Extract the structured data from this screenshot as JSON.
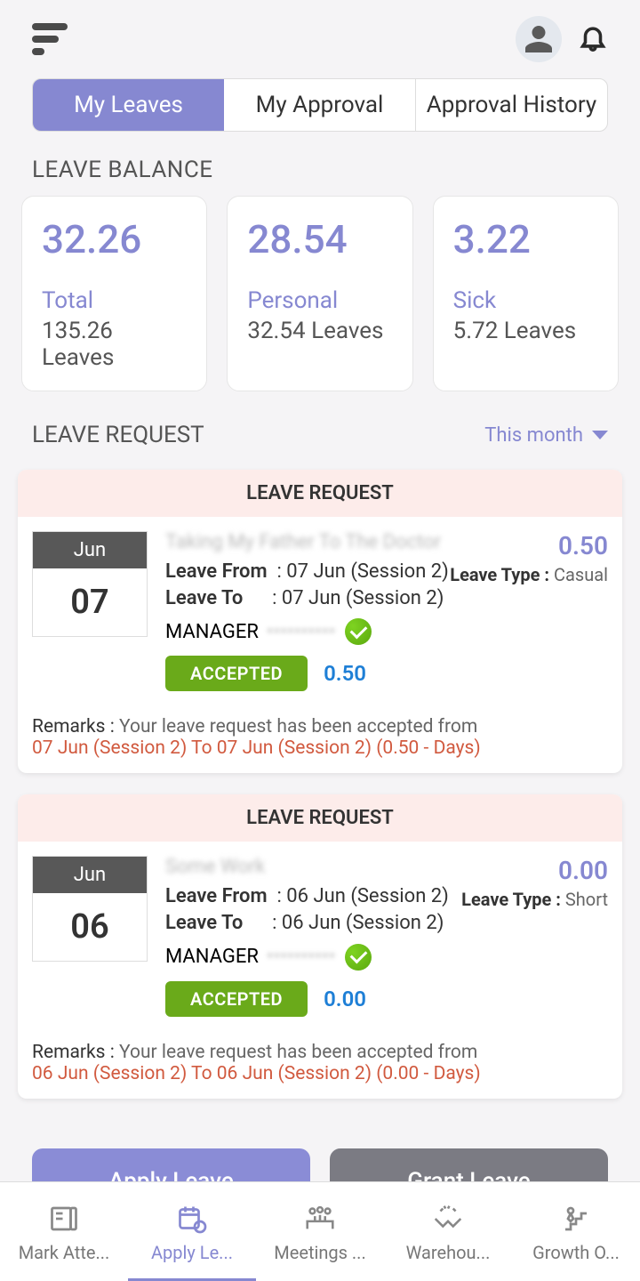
{
  "header": {},
  "tabs": {
    "my_leaves": "My Leaves",
    "my_approval": "My Approval",
    "approval_history": "Approval History"
  },
  "sections": {
    "balance_title": "LEAVE BALANCE",
    "request_title": "LEAVE REQUEST"
  },
  "balance": [
    {
      "value": "32.26",
      "label": "Total",
      "sub": "135.26 Leaves"
    },
    {
      "value": "28.54",
      "label": "Personal",
      "sub": "32.54 Leaves"
    },
    {
      "value": "3.22",
      "label": "Sick",
      "sub": "5.72 Leaves"
    }
  ],
  "filter": {
    "label": "This month"
  },
  "leaves": [
    {
      "header": "LEAVE REQUEST",
      "month": "Jun",
      "day": "07",
      "reason": "Taking My Father To The Doctor",
      "amount": "0.50",
      "from_label": "Leave From",
      "from_value": "07 Jun (Session 2)",
      "to_label": "Leave To",
      "to_value": "07 Jun (Session 2)",
      "leave_type_label": "Leave Type :",
      "leave_type_value": "Casual",
      "manager_label": "MANAGER",
      "manager_name": "··········",
      "status": "ACCEPTED",
      "status_amount": "0.50",
      "remarks_label": "Remarks :",
      "remarks_text": "Your leave request has been accepted from",
      "remarks_highlight": "07 Jun (Session 2) To 07 Jun (Session 2) (0.50 - Days)"
    },
    {
      "header": "LEAVE REQUEST",
      "month": "Jun",
      "day": "06",
      "reason": "Some Work",
      "amount": "0.00",
      "from_label": "Leave From",
      "from_value": "06 Jun (Session 2)",
      "to_label": "Leave To",
      "to_value": "06 Jun (Session 2)",
      "leave_type_label": "Leave Type :",
      "leave_type_value": "Short",
      "manager_label": "MANAGER",
      "manager_name": "··········",
      "status": "ACCEPTED",
      "status_amount": "0.00",
      "remarks_label": "Remarks :",
      "remarks_text": "Your leave request has been accepted from",
      "remarks_highlight": "06 Jun (Session 2) To 06 Jun (Session 2) (0.00 - Days)"
    }
  ],
  "actions": {
    "apply": "Apply Leave",
    "grant": "Grant Leave"
  },
  "nav": {
    "mark": "Mark Atte...",
    "apply": "Apply Le...",
    "meetings": "Meetings ...",
    "warehouse": "Warehou...",
    "growth": "Growth O..."
  }
}
